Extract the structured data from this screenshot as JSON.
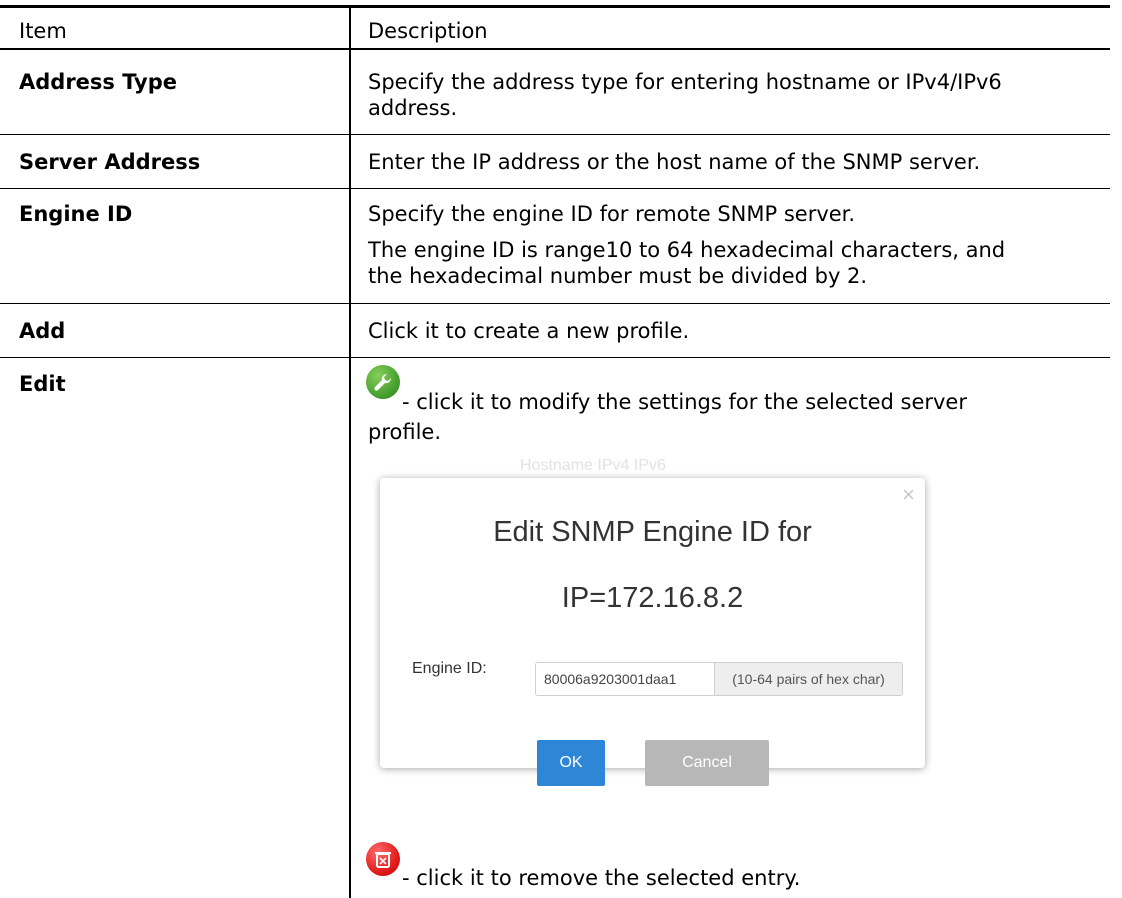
{
  "table": {
    "header": {
      "item": "Item",
      "description": "Description"
    },
    "rows": [
      {
        "item": "Address Type",
        "desc": [
          "Specify the address type for entering hostname or IPv4/IPv6",
          "address."
        ]
      },
      {
        "item": "Server Address",
        "desc": [
          "Enter the IP address or the host name of the SNMP server."
        ]
      },
      {
        "item": "Engine ID",
        "desc": [
          "Specify the engine ID for remote SNMP server.",
          "The engine ID is range10 to 64 hexadecimal characters, and",
          "the hexadecimal number must be divided by 2."
        ]
      },
      {
        "item": "Add",
        "desc": [
          "Click it to create a new profile."
        ]
      },
      {
        "item": "Edit",
        "edit_text": "- click it to modify the settings for the selected server",
        "edit_text2": "profile.",
        "delete_text": "- click it to remove the selected entry."
      }
    ]
  },
  "dialog": {
    "ghost_text": "Hostname   IPv4   IPv6",
    "title_line1": "Edit SNMP Engine ID for",
    "title_line2": "IP=172.16.8.2",
    "engine_label": "Engine ID:",
    "engine_value": "80006a9203001daa1",
    "engine_hint": "(10-64 pairs of hex char)",
    "ok": "OK",
    "cancel": "Cancel",
    "close": "×"
  },
  "icons": {
    "edit": "wrench-icon",
    "delete": "trash-icon"
  },
  "colors": {
    "ok_button": "#2e86d6",
    "cancel_button": "#b7b7b7",
    "edit_icon": "#3f9a2b",
    "delete_icon": "#e01818"
  }
}
